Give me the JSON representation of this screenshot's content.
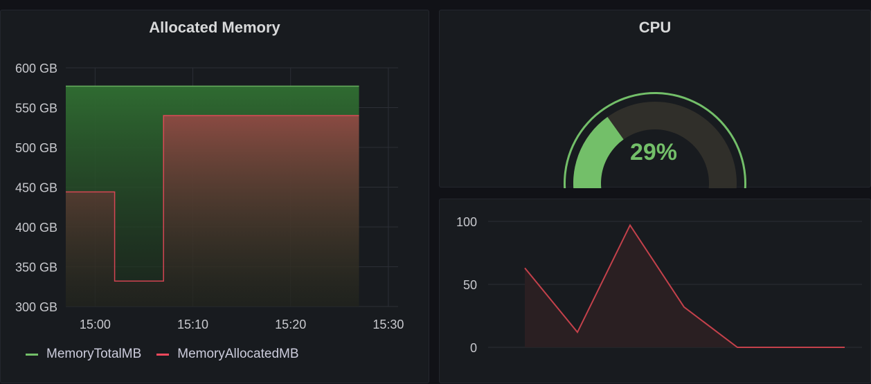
{
  "memory_panel": {
    "title": "Allocated Memory",
    "legend": [
      {
        "label": "MemoryTotalMB",
        "color": "#73bf69"
      },
      {
        "label": "MemoryAllocatedMB",
        "color": "#f2495c"
      }
    ]
  },
  "cpu_panel": {
    "title": "CPU",
    "value_text": "29%",
    "value": 29,
    "min": 0,
    "max": 100,
    "threshold": 95,
    "colors": {
      "ok": "#73bf69",
      "bad": "#c4414b",
      "value": "#73bf69"
    }
  },
  "chart_data": [
    {
      "type": "area",
      "title": "Allocated Memory",
      "ylim": [
        300,
        600
      ],
      "yticks": [
        "600 GB",
        "550 GB",
        "500 GB",
        "450 GB",
        "400 GB",
        "350 GB",
        "300 GB"
      ],
      "ytick_values": [
        600,
        550,
        500,
        450,
        400,
        350,
        300
      ],
      "xticks": [
        "15:00",
        "15:10",
        "15:20",
        "15:30"
      ],
      "xtick_values": [
        900,
        910,
        920,
        930
      ],
      "xlim": [
        897,
        931
      ],
      "series": [
        {
          "name": "MemoryTotalMB",
          "color": "#73bf69",
          "x": [
            897,
            927
          ],
          "y": [
            577,
            577
          ]
        },
        {
          "name": "MemoryAllocatedMB",
          "color": "#f2495c",
          "x": [
            897,
            902,
            902,
            907,
            907,
            927
          ],
          "y": [
            444,
            444,
            332,
            332,
            540,
            540
          ]
        }
      ]
    },
    {
      "type": "area",
      "ylim": [
        0,
        100
      ],
      "yticks": [
        "100",
        "50",
        "0"
      ],
      "ytick_values": [
        100,
        50,
        0
      ],
      "series": [
        {
          "color": "#c4414b",
          "x": [
            0,
            1,
            2,
            3,
            4,
            5
          ],
          "y": [
            63,
            12,
            97,
            32,
            0,
            0
          ]
        }
      ]
    }
  ]
}
